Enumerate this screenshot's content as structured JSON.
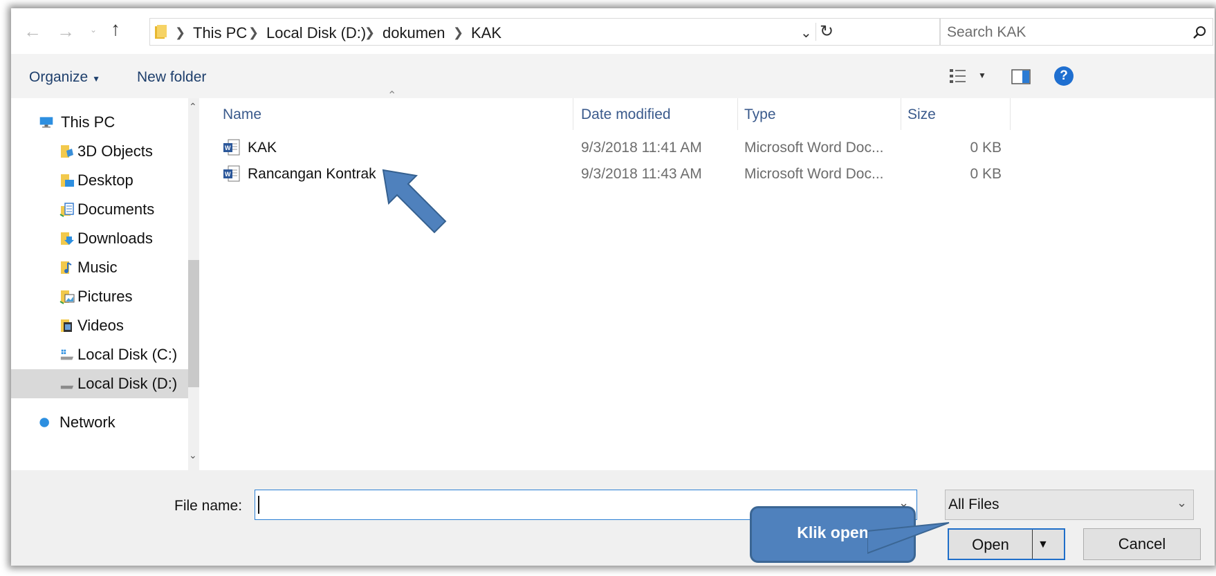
{
  "address_bar": {
    "crumbs": [
      "This PC",
      "Local Disk (D:)",
      "dokumen",
      "KAK"
    ],
    "search_placeholder": "Search KAK"
  },
  "toolbar": {
    "organize_label": "Organize",
    "new_folder_label": "New folder",
    "help_label": "?"
  },
  "nav_pane": {
    "items": [
      {
        "label": "This PC",
        "icon": "computer-icon"
      },
      {
        "label": "3D Objects",
        "icon": "3d-objects-folder-icon"
      },
      {
        "label": "Desktop",
        "icon": "desktop-folder-icon"
      },
      {
        "label": "Documents",
        "icon": "documents-folder-icon"
      },
      {
        "label": "Downloads",
        "icon": "downloads-folder-icon"
      },
      {
        "label": "Music",
        "icon": "music-folder-icon"
      },
      {
        "label": "Pictures",
        "icon": "pictures-folder-icon"
      },
      {
        "label": "Videos",
        "icon": "videos-folder-icon"
      },
      {
        "label": "Local Disk (C:)",
        "icon": "windows-drive-icon"
      },
      {
        "label": "Local Disk (D:)",
        "icon": "drive-icon",
        "selected": true
      },
      {
        "label": "Network",
        "icon": "network-icon"
      }
    ]
  },
  "file_list": {
    "columns": [
      "Name",
      "Date modified",
      "Type",
      "Size"
    ],
    "rows": [
      {
        "name": "KAK",
        "date": "9/3/2018 11:41 AM",
        "type": "Microsoft Word Doc...",
        "size": "0 KB"
      },
      {
        "name": "Rancangan Kontrak",
        "date": "9/3/2018 11:43 AM",
        "type": "Microsoft Word Doc...",
        "size": "0 KB"
      }
    ]
  },
  "bottom": {
    "file_name_label": "File name:",
    "file_name_value": "",
    "filter_value": "All Files",
    "open_label": "Open",
    "cancel_label": "Cancel"
  },
  "annotations": {
    "callout_text": "Klik open"
  },
  "colors": {
    "accent": "#1e6ec9",
    "callout": "#4f81bd",
    "link_text": "#1e3f6c"
  }
}
